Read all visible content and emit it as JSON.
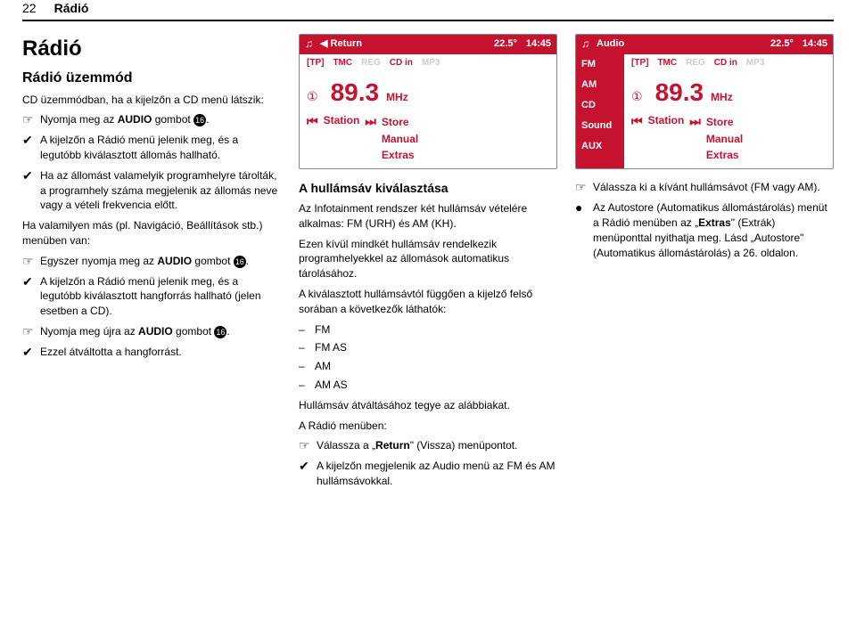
{
  "header": {
    "pagenum": "22",
    "title": "Rádió"
  },
  "col1": {
    "h1": "Rádió",
    "h2": "Rádió üzemmód",
    "intro": "CD üzemmódban, ha a kijelzőn a CD menü látszik:",
    "r1_pre": "Nyomja meg az ",
    "r1_bold": "AUDIO",
    "r1_post": " gombot ",
    "r1_num": "16",
    "r2": "A kijelzőn a Rádió menü jelenik meg, és a legutóbb kiválasztott állomás hallható.",
    "r3": "Ha az állomást valamelyik programhelyre tárolták, a programhely száma megjelenik az állomás neve vagy a vételi frekvencia előtt.",
    "p4": "Ha valamilyen más (pl. Navigáció, Beállítások stb.) menüben van:",
    "r5_pre": "Egyszer nyomja meg az ",
    "r5_bold": "AUDIO",
    "r5_post": " gombot ",
    "r5_num": "16",
    "r6": "A kijelzőn a Rádió menü jelenik meg, és a legutóbb kiválasztott hangforrás hallható (jelen esetben a CD).",
    "r7_pre": "Nyomja meg újra az ",
    "r7_bold": "AUDIO",
    "r7_post": " gombot ",
    "r7_num": "16",
    "r8": "Ezzel átváltotta a hangforrást."
  },
  "screen1": {
    "return": "◀ Return",
    "deg": "22.5°",
    "time": "14:45",
    "ind": {
      "tp": "[TP]",
      "tmc": "TMC",
      "reg": "REG",
      "cdin": "CD in",
      "mp3": "MP3"
    },
    "circ": "①",
    "freq": "89.3",
    "mhz": "MHz",
    "prev": "⏮",
    "station": "Station",
    "next": "⏭",
    "store": "Store",
    "manual": "Manual",
    "extras": "Extras"
  },
  "col2": {
    "h3": "A hullámsáv kiválasztása",
    "p1": "Az Infotainment rendszer két hullámsáv vételére alkalmas: FM (URH) és AM (KH).",
    "p2": "Ezen kívül mindkét hullámsáv rendelkezik programhelyekkel az állomások automatikus tárolásához.",
    "p3": "A kiválasztott hullámsávtól függően a kijelző felső sorában a következők láthatók:",
    "d1": "FM",
    "d2": "FM AS",
    "d3": "AM",
    "d4": "AM AS",
    "p5": "Hullámsáv átváltásához tegye az alábbiakat.",
    "p6": "A Rádió menüben:",
    "r7_pre": "Válassza a „",
    "r7_bold": "Return",
    "r7_post": "\" (Vissza) menüpontot.",
    "r8": "A kijelzőn megjelenik az Audio menü az FM és AM hullámsávokkal."
  },
  "screen2": {
    "audio": "Audio",
    "deg": "22.5°",
    "time": "14:45",
    "side": {
      "fm": "FM",
      "am": "AM",
      "cd": "CD",
      "sound": "Sound",
      "aux": "AUX"
    },
    "ind": {
      "tp": "[TP]",
      "tmc": "TMC",
      "reg": "REG",
      "cdin": "CD in",
      "mp3": "MP3"
    },
    "circ": "①",
    "freq": "89.3",
    "mhz": "MHz",
    "prev": "⏮",
    "station": "Station",
    "next": "⏭",
    "store": "Store",
    "manual": "Manual",
    "extras": "Extras"
  },
  "col3": {
    "r1": "Válassza ki a kívánt hullámsávot (FM vagy AM).",
    "r2_pre": "Az Autostore (Automatikus állomástárolás) menüt a Rádió menüben az „",
    "r2_bold": "Extras",
    "r2_post": "\" (Extrák) menüponttal nyithatja meg. Lásd „Autostore\" (Automatikus állomástárolás) a 26. oldalon."
  }
}
